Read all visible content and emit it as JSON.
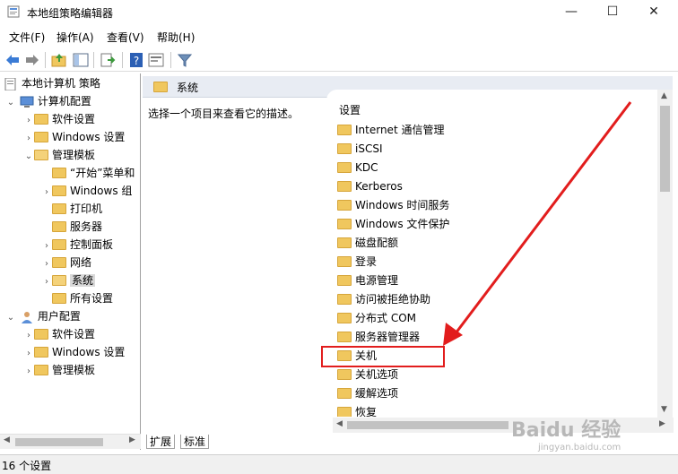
{
  "window": {
    "title": "本地组策略编辑器",
    "minimize": "—",
    "maximize": "☐",
    "close": "✕"
  },
  "menu": [
    "文件(F)",
    "操作(A)",
    "查看(V)",
    "帮助(H)"
  ],
  "toolbar_icons": [
    "back-arrow-icon",
    "forward-arrow-icon",
    "up-folder-icon",
    "show-hide-tree-icon",
    "export-list-icon",
    "help-icon",
    "properties-icon",
    "filter-icon"
  ],
  "tree": {
    "root": "本地计算机 策略",
    "computer_config": "计算机配置",
    "cc_software": "软件设置",
    "cc_windows": "Windows 设置",
    "cc_admin": "管理模板",
    "start_menu": "“开始”菜单和",
    "windows_comp": "Windows 组",
    "printers": "打印机",
    "servers": "服务器",
    "control_panel": "控制面板",
    "network": "网络",
    "system": "系统",
    "all_settings": "所有设置",
    "user_config": "用户配置",
    "uc_software": "软件设置",
    "uc_windows": "Windows 设置",
    "uc_admin": "管理模板"
  },
  "right": {
    "header": "系统",
    "description": "选择一个项目来查看它的描述。",
    "list_header": "设置",
    "items": [
      "Internet 通信管理",
      "iSCSI",
      "KDC",
      "Kerberos",
      "Windows 时间服务",
      "Windows 文件保护",
      "磁盘配额",
      "登录",
      "电源管理",
      "访问被拒绝协助",
      "分布式 COM",
      "服务器管理器",
      "关机",
      "关机选项",
      "缓解选项",
      "恢复"
    ]
  },
  "tabs": [
    "扩展",
    "标准"
  ],
  "status": "16 个设置",
  "watermark": {
    "brand": "Baidu 经验",
    "url": "jingyan.baidu.com"
  },
  "colors": {
    "annotation": "#e21d1d",
    "selection": "#d9d9d9",
    "folder": "#f0c75e"
  }
}
